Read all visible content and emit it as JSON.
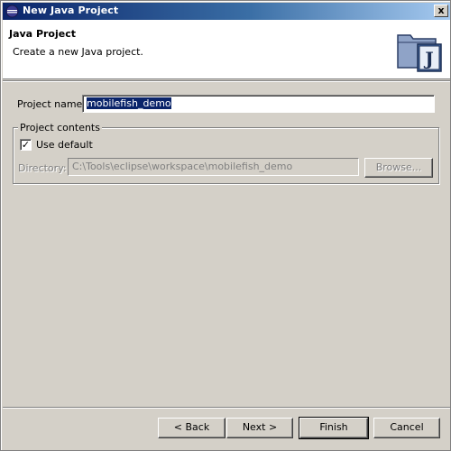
{
  "window": {
    "title": "New Java Project",
    "title_icon": "eclipse-icon",
    "close_label": "x"
  },
  "header": {
    "title": "Java Project",
    "description": "Create a new Java project.",
    "graphic": "java-project-folder-icon",
    "graphic_letter": "J"
  },
  "form": {
    "project_name_label": "Project name:",
    "project_name_value": "mobilefish_demo"
  },
  "project_contents": {
    "legend": "Project contents",
    "use_default_label": "Use default",
    "use_default_checked": true,
    "check_mark": "✓",
    "directory_label": "Directory:",
    "directory_value": "C:\\Tools\\eclipse\\workspace\\mobilefish_demo",
    "browse_label": "Browse..."
  },
  "buttons": {
    "back": "< Back",
    "next": "Next >",
    "finish": "Finish",
    "cancel": "Cancel"
  }
}
